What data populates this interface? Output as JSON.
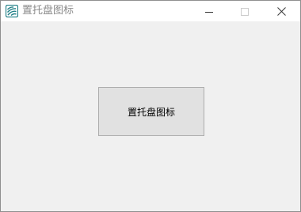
{
  "window": {
    "title": "置托盘图标",
    "icon": "app-icon",
    "controls": {
      "minimize_icon": "minimize-icon",
      "maximize_icon": "maximize-icon",
      "close_icon": "close-icon"
    }
  },
  "main": {
    "button_label": "置托盘图标"
  },
  "colors": {
    "titlebar": "#ffffff",
    "client": "#f0f0f0",
    "button_face": "#e1e1e1",
    "button_border": "#adadad",
    "title_text": "#8a8a8a",
    "icon_accent": "#1f8a8a"
  }
}
